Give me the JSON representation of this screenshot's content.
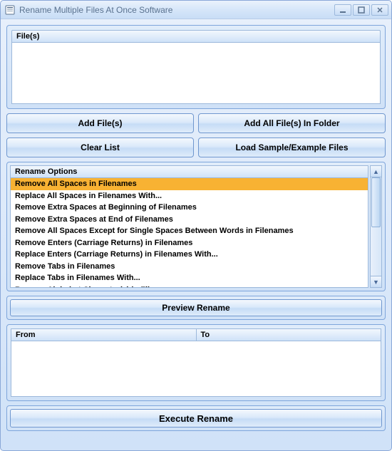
{
  "window": {
    "title": "Rename Multiple Files At Once Software"
  },
  "files": {
    "header": "File(s)"
  },
  "buttons": {
    "add_files": "Add File(s)",
    "add_folder": "Add All File(s) In Folder",
    "clear_list": "Clear List",
    "load_sample": "Load Sample/Example Files",
    "preview": "Preview Rename",
    "execute": "Execute Rename"
  },
  "options": {
    "header": "Rename Options",
    "selected_index": 0,
    "items": [
      "Remove All Spaces in Filenames",
      "Replace All Spaces in Filenames With...",
      "Remove Extra Spaces at Beginning of Filenames",
      "Remove Extra Spaces at End of Filenames",
      "Remove All Spaces Except for Single Spaces Between Words in Filenames",
      "Remove Enters (Carriage Returns) in Filenames",
      "Replace Enters (Carriage Returns) in Filenames With...",
      "Remove Tabs in Filenames",
      "Replace Tabs in Filenames With...",
      "Remove Alphabet Character(s) in Filenames"
    ]
  },
  "fromto": {
    "from": "From",
    "to": "To"
  }
}
